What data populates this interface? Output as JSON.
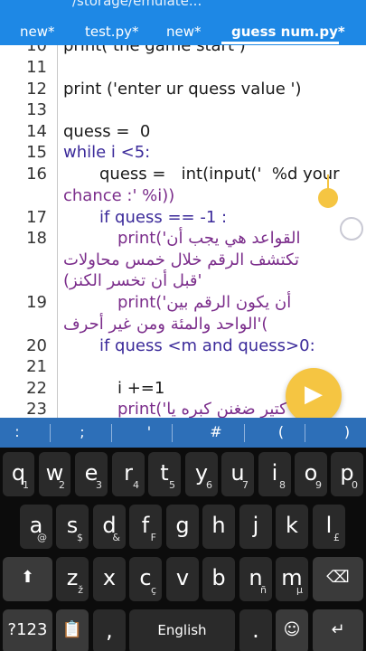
{
  "path": "/storage/emulate...",
  "tabs": [
    "new*",
    "test.py*",
    "new*",
    "guess num.py*"
  ],
  "editor": {
    "lines": [
      {
        "num": "10",
        "code": "print( the game start )"
      },
      {
        "num": "11",
        "code": ""
      },
      {
        "num": "12",
        "code": "print ('enter ur quess value ')"
      },
      {
        "num": "13",
        "code": ""
      },
      {
        "num": "14",
        "code": "quess =  0"
      },
      {
        "num": "15",
        "code": "while i <5:"
      },
      {
        "num": "16",
        "code": "quess =   int(input('  %d your"
      },
      {
        "num": "",
        "code": "chance :' %i))"
      },
      {
        "num": "17",
        "code": "if quess == -1 :"
      },
      {
        "num": "18",
        "code": "print('القواعد هي يجب أن"
      },
      {
        "num": "",
        "code": "تكتشف الرقم خلال خمس محاولات"
      },
      {
        "num": "",
        "code": "(قبل أن تخسر الكنز'"
      },
      {
        "num": "19",
        "code": "print('أن يكون الرقم بين"
      },
      {
        "num": "",
        "code": "الواحد والمئة ومن غير أحرف'("
      },
      {
        "num": "20",
        "code": "if quess <m and quess>0:"
      },
      {
        "num": "21",
        "code": ""
      },
      {
        "num": "22",
        "code": "i +=1"
      },
      {
        "num": "23",
        "code": "print('كتير ضغنن كبره يا"
      }
    ]
  },
  "symbols": [
    ":",
    ";",
    "'",
    "#",
    "(",
    ")"
  ],
  "keyboard": {
    "row1": [
      {
        "k": "q",
        "a": "1"
      },
      {
        "k": "w",
        "a": "2"
      },
      {
        "k": "e",
        "a": "3"
      },
      {
        "k": "r",
        "a": "4"
      },
      {
        "k": "t",
        "a": "5"
      },
      {
        "k": "y",
        "a": "6"
      },
      {
        "k": "u",
        "a": "7"
      },
      {
        "k": "i",
        "a": "8"
      },
      {
        "k": "o",
        "a": "9"
      },
      {
        "k": "p",
        "a": "0"
      }
    ],
    "row2": [
      {
        "k": "a",
        "a": "@"
      },
      {
        "k": "s",
        "a": "$"
      },
      {
        "k": "d",
        "a": "&"
      },
      {
        "k": "f",
        "a": "F"
      },
      {
        "k": "g",
        "a": ""
      },
      {
        "k": "h",
        "a": ""
      },
      {
        "k": "j",
        "a": ""
      },
      {
        "k": "k",
        "a": ""
      },
      {
        "k": "l",
        "a": "£"
      }
    ],
    "row3": [
      {
        "k": "z",
        "a": "ž"
      },
      {
        "k": "x",
        "a": ""
      },
      {
        "k": "c",
        "a": "ç"
      },
      {
        "k": "v",
        "a": ""
      },
      {
        "k": "b",
        "a": ""
      },
      {
        "k": "n",
        "a": "ñ"
      },
      {
        "k": "m",
        "a": "μ"
      }
    ],
    "numbers_label": "?123",
    "space_label": "English"
  },
  "colors": {
    "accent": "#1e88e5",
    "fab": "#f5c542",
    "symbar": "#2d6fb8"
  }
}
